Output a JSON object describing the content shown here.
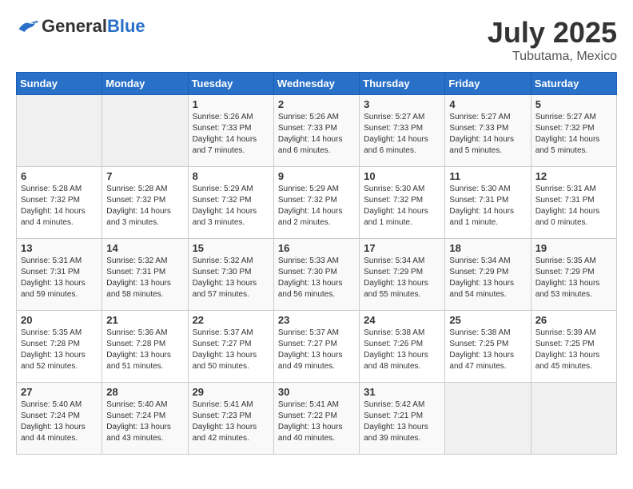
{
  "header": {
    "logo_general": "General",
    "logo_blue": "Blue",
    "month_year": "July 2025",
    "location": "Tubutama, Mexico"
  },
  "days_of_week": [
    "Sunday",
    "Monday",
    "Tuesday",
    "Wednesday",
    "Thursday",
    "Friday",
    "Saturday"
  ],
  "weeks": [
    [
      {
        "num": "",
        "sunrise": "",
        "sunset": "",
        "daylight": ""
      },
      {
        "num": "",
        "sunrise": "",
        "sunset": "",
        "daylight": ""
      },
      {
        "num": "1",
        "sunrise": "Sunrise: 5:26 AM",
        "sunset": "Sunset: 7:33 PM",
        "daylight": "Daylight: 14 hours and 7 minutes."
      },
      {
        "num": "2",
        "sunrise": "Sunrise: 5:26 AM",
        "sunset": "Sunset: 7:33 PM",
        "daylight": "Daylight: 14 hours and 6 minutes."
      },
      {
        "num": "3",
        "sunrise": "Sunrise: 5:27 AM",
        "sunset": "Sunset: 7:33 PM",
        "daylight": "Daylight: 14 hours and 6 minutes."
      },
      {
        "num": "4",
        "sunrise": "Sunrise: 5:27 AM",
        "sunset": "Sunset: 7:33 PM",
        "daylight": "Daylight: 14 hours and 5 minutes."
      },
      {
        "num": "5",
        "sunrise": "Sunrise: 5:27 AM",
        "sunset": "Sunset: 7:32 PM",
        "daylight": "Daylight: 14 hours and 5 minutes."
      }
    ],
    [
      {
        "num": "6",
        "sunrise": "Sunrise: 5:28 AM",
        "sunset": "Sunset: 7:32 PM",
        "daylight": "Daylight: 14 hours and 4 minutes."
      },
      {
        "num": "7",
        "sunrise": "Sunrise: 5:28 AM",
        "sunset": "Sunset: 7:32 PM",
        "daylight": "Daylight: 14 hours and 3 minutes."
      },
      {
        "num": "8",
        "sunrise": "Sunrise: 5:29 AM",
        "sunset": "Sunset: 7:32 PM",
        "daylight": "Daylight: 14 hours and 3 minutes."
      },
      {
        "num": "9",
        "sunrise": "Sunrise: 5:29 AM",
        "sunset": "Sunset: 7:32 PM",
        "daylight": "Daylight: 14 hours and 2 minutes."
      },
      {
        "num": "10",
        "sunrise": "Sunrise: 5:30 AM",
        "sunset": "Sunset: 7:32 PM",
        "daylight": "Daylight: 14 hours and 1 minute."
      },
      {
        "num": "11",
        "sunrise": "Sunrise: 5:30 AM",
        "sunset": "Sunset: 7:31 PM",
        "daylight": "Daylight: 14 hours and 1 minute."
      },
      {
        "num": "12",
        "sunrise": "Sunrise: 5:31 AM",
        "sunset": "Sunset: 7:31 PM",
        "daylight": "Daylight: 14 hours and 0 minutes."
      }
    ],
    [
      {
        "num": "13",
        "sunrise": "Sunrise: 5:31 AM",
        "sunset": "Sunset: 7:31 PM",
        "daylight": "Daylight: 13 hours and 59 minutes."
      },
      {
        "num": "14",
        "sunrise": "Sunrise: 5:32 AM",
        "sunset": "Sunset: 7:31 PM",
        "daylight": "Daylight: 13 hours and 58 minutes."
      },
      {
        "num": "15",
        "sunrise": "Sunrise: 5:32 AM",
        "sunset": "Sunset: 7:30 PM",
        "daylight": "Daylight: 13 hours and 57 minutes."
      },
      {
        "num": "16",
        "sunrise": "Sunrise: 5:33 AM",
        "sunset": "Sunset: 7:30 PM",
        "daylight": "Daylight: 13 hours and 56 minutes."
      },
      {
        "num": "17",
        "sunrise": "Sunrise: 5:34 AM",
        "sunset": "Sunset: 7:29 PM",
        "daylight": "Daylight: 13 hours and 55 minutes."
      },
      {
        "num": "18",
        "sunrise": "Sunrise: 5:34 AM",
        "sunset": "Sunset: 7:29 PM",
        "daylight": "Daylight: 13 hours and 54 minutes."
      },
      {
        "num": "19",
        "sunrise": "Sunrise: 5:35 AM",
        "sunset": "Sunset: 7:29 PM",
        "daylight": "Daylight: 13 hours and 53 minutes."
      }
    ],
    [
      {
        "num": "20",
        "sunrise": "Sunrise: 5:35 AM",
        "sunset": "Sunset: 7:28 PM",
        "daylight": "Daylight: 13 hours and 52 minutes."
      },
      {
        "num": "21",
        "sunrise": "Sunrise: 5:36 AM",
        "sunset": "Sunset: 7:28 PM",
        "daylight": "Daylight: 13 hours and 51 minutes."
      },
      {
        "num": "22",
        "sunrise": "Sunrise: 5:37 AM",
        "sunset": "Sunset: 7:27 PM",
        "daylight": "Daylight: 13 hours and 50 minutes."
      },
      {
        "num": "23",
        "sunrise": "Sunrise: 5:37 AM",
        "sunset": "Sunset: 7:27 PM",
        "daylight": "Daylight: 13 hours and 49 minutes."
      },
      {
        "num": "24",
        "sunrise": "Sunrise: 5:38 AM",
        "sunset": "Sunset: 7:26 PM",
        "daylight": "Daylight: 13 hours and 48 minutes."
      },
      {
        "num": "25",
        "sunrise": "Sunrise: 5:38 AM",
        "sunset": "Sunset: 7:25 PM",
        "daylight": "Daylight: 13 hours and 47 minutes."
      },
      {
        "num": "26",
        "sunrise": "Sunrise: 5:39 AM",
        "sunset": "Sunset: 7:25 PM",
        "daylight": "Daylight: 13 hours and 45 minutes."
      }
    ],
    [
      {
        "num": "27",
        "sunrise": "Sunrise: 5:40 AM",
        "sunset": "Sunset: 7:24 PM",
        "daylight": "Daylight: 13 hours and 44 minutes."
      },
      {
        "num": "28",
        "sunrise": "Sunrise: 5:40 AM",
        "sunset": "Sunset: 7:24 PM",
        "daylight": "Daylight: 13 hours and 43 minutes."
      },
      {
        "num": "29",
        "sunrise": "Sunrise: 5:41 AM",
        "sunset": "Sunset: 7:23 PM",
        "daylight": "Daylight: 13 hours and 42 minutes."
      },
      {
        "num": "30",
        "sunrise": "Sunrise: 5:41 AM",
        "sunset": "Sunset: 7:22 PM",
        "daylight": "Daylight: 13 hours and 40 minutes."
      },
      {
        "num": "31",
        "sunrise": "Sunrise: 5:42 AM",
        "sunset": "Sunset: 7:21 PM",
        "daylight": "Daylight: 13 hours and 39 minutes."
      },
      {
        "num": "",
        "sunrise": "",
        "sunset": "",
        "daylight": ""
      },
      {
        "num": "",
        "sunrise": "",
        "sunset": "",
        "daylight": ""
      }
    ]
  ]
}
